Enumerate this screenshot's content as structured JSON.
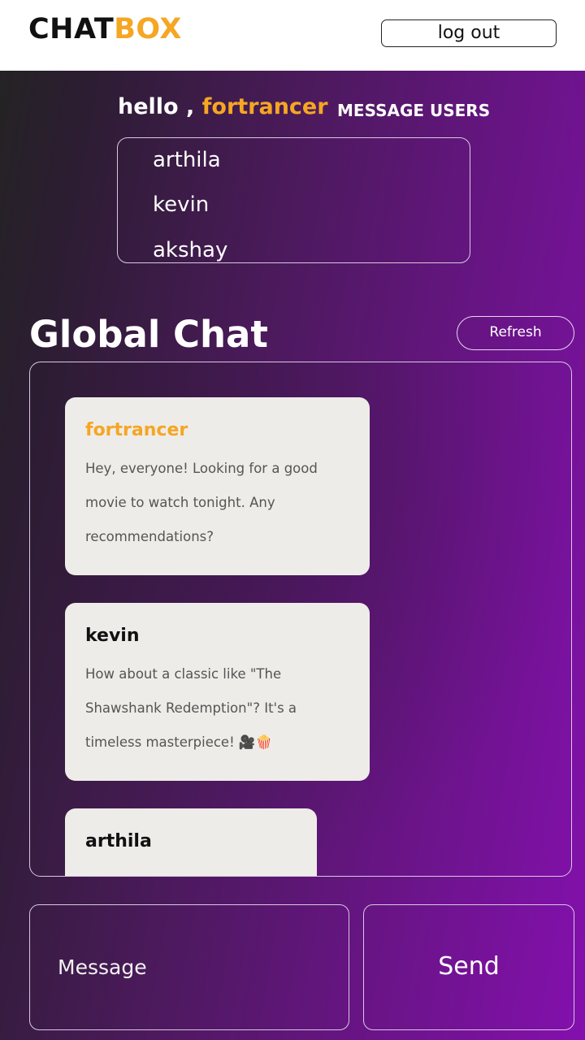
{
  "header": {
    "logo_part1": "CHAT",
    "logo_part2": "BOX",
    "logout_label": "log out"
  },
  "greeting": {
    "hello": "hello , ",
    "username": "fortrancer",
    "message_users_label": "MESSAGE USERS"
  },
  "users": [
    "arthila",
    "kevin",
    "akshay"
  ],
  "global_chat": {
    "title": "Global Chat",
    "refresh_label": "Refresh",
    "messages": [
      {
        "sender": "fortrancer",
        "text": "Hey, everyone! Looking for a good movie to watch tonight. Any recommendations?"
      },
      {
        "sender": "kevin",
        "text": "How about a classic like \"The Shawshank Redemption\"? It's a timeless masterpiece! 🎥🍿"
      },
      {
        "sender": "arthila",
        "text": ""
      }
    ]
  },
  "composer": {
    "placeholder": "Message",
    "send_label": "Send"
  },
  "colors": {
    "accent": "#f5a623",
    "gradient_start": "#242324",
    "gradient_end": "#8410ae",
    "bubble_bg": "#eeece9"
  }
}
